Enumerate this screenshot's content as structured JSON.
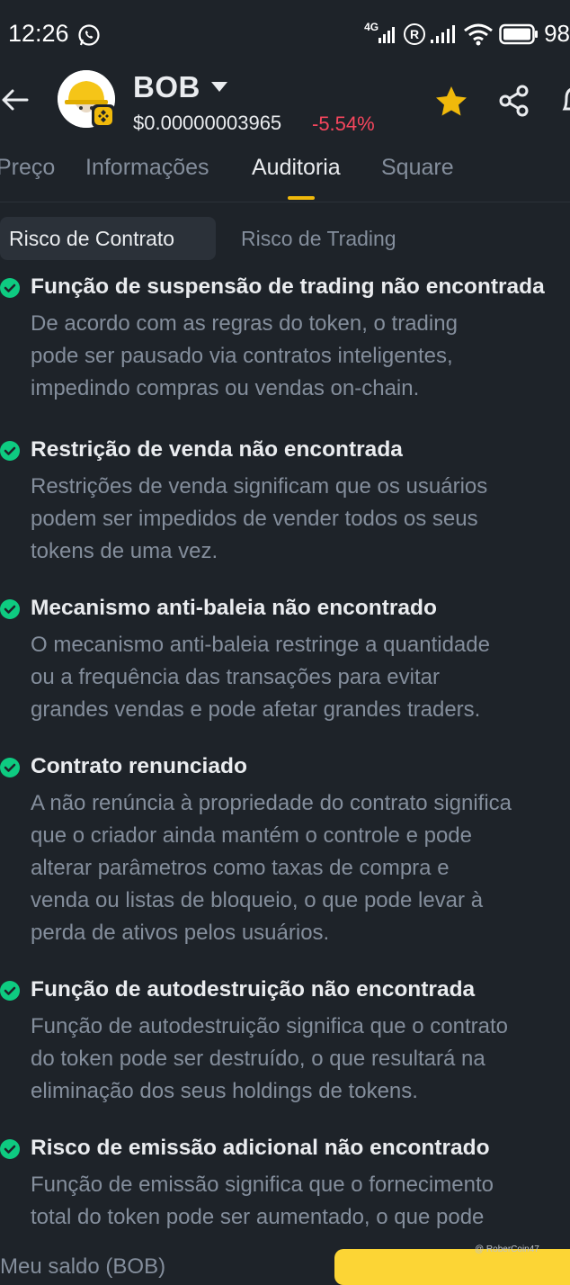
{
  "status_bar": {
    "time": "12:26",
    "network_label": "4G",
    "battery": "98"
  },
  "header": {
    "token_name": "BOB",
    "price": "$0.00000003965",
    "change": "-5.54%",
    "colors": {
      "negative": "#f6465d",
      "accent": "#f0b90b",
      "check": "#0ecb81"
    }
  },
  "tabs": [
    {
      "label": "Preço"
    },
    {
      "label": "Informações"
    },
    {
      "label": "Auditoria"
    },
    {
      "label": "Square"
    }
  ],
  "subtabs": [
    {
      "label": "Risco de Contrato"
    },
    {
      "label": "Risco de Trading"
    }
  ],
  "items": [
    {
      "title": "Função de suspensão de trading não encontrada",
      "description": "De acordo com as regras do token, o trading\npode ser pausado via contratos inteligentes,\nimpedindo compras ou vendas on-chain."
    },
    {
      "title": "Restrição de venda não encontrada",
      "description": "Restrições de venda significam que os usuários\npodem ser impedidos de vender todos os seus\ntokens de uma vez."
    },
    {
      "title": "Mecanismo anti-baleia não encontrado",
      "description": "O mecanismo anti-baleia restringe a quantidade\nou a frequência das transações para evitar\ngrandes vendas e pode afetar grandes traders."
    },
    {
      "title": "Contrato renunciado",
      "description": "A não renúncia à propriedade do contrato significa\nque o criador ainda mantém o controle e pode\nalterar parâmetros como taxas de compra e\nvenda ou listas de bloqueio, o que pode levar à\nperda de ativos pelos usuários."
    },
    {
      "title": "Função de autodestruição não encontrada",
      "description": "Função de autodestruição significa que o contrato\ndo token pode ser destruído, o que resultará na\neliminação dos seus holdings de tokens."
    },
    {
      "title": "Risco de emissão adicional não encontrado",
      "description": "Função de emissão significa que o fornecimento\ntotal do token pode ser aumentado, o que pode"
    }
  ],
  "bottom": {
    "balance_label": "Meu saldo (BOB)",
    "watermark": "@ RoberCoin47"
  }
}
